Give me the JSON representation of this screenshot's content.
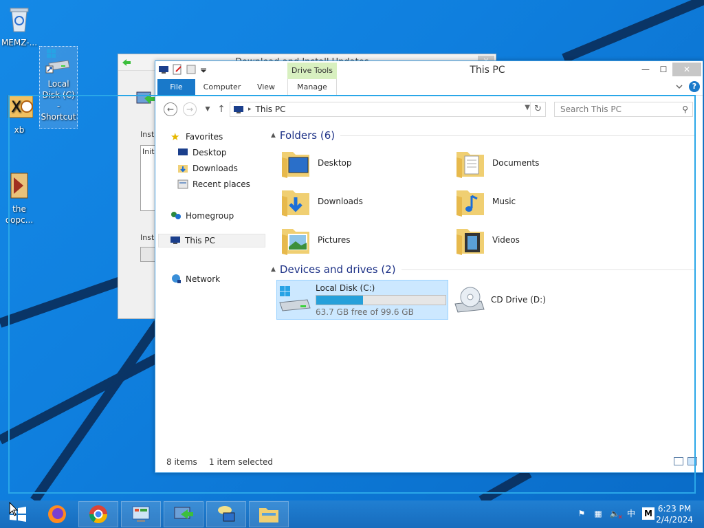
{
  "desktop": {
    "icons": [
      {
        "label": "MEMZ-..."
      },
      {
        "label": "Local Disk (C) - Shortcut"
      },
      {
        "label": "xb"
      },
      {
        "label": "the oopc..."
      }
    ]
  },
  "background_window": {
    "title": "Download and Install Updates",
    "close": "✕",
    "label1": "Insta",
    "box_text": "Init",
    "label2": "Insta"
  },
  "explorer": {
    "title": "This PC",
    "contextual_tab": "Drive Tools",
    "tabs": [
      "File",
      "Computer",
      "View",
      "Manage"
    ],
    "controls": {
      "minimize": "—",
      "maximize": "☐",
      "close": "✕"
    },
    "help": "?",
    "address": {
      "path": "This PC",
      "separator": "▸"
    },
    "search": {
      "placeholder": "Search This PC"
    },
    "nav": {
      "favorites": "Favorites",
      "desktop": "Desktop",
      "downloads": "Downloads",
      "recent": "Recent places",
      "homegroup": "Homegroup",
      "this_pc": "This PC",
      "network": "Network"
    },
    "folders_header": "Folders (6)",
    "folders": [
      "Desktop",
      "Documents",
      "Downloads",
      "Music",
      "Pictures",
      "Videos"
    ],
    "devices_header": "Devices and drives (2)",
    "drives": [
      {
        "name": "Local Disk (C:)",
        "free": "63.7 GB free of 99.6 GB",
        "used_fraction": 0.36
      },
      {
        "name": "CD Drive (D:)"
      }
    ],
    "status": {
      "items": "8 items",
      "selected": "1 item selected"
    }
  },
  "taskbar": {
    "ime": "中",
    "ime_mode": "M",
    "time": "6:23 PM",
    "date": "2/4/2024"
  },
  "colors": {
    "accent": "#1979ca",
    "selection": "#cce8ff",
    "progress": "#26a0da",
    "header_text": "#1e3287"
  }
}
